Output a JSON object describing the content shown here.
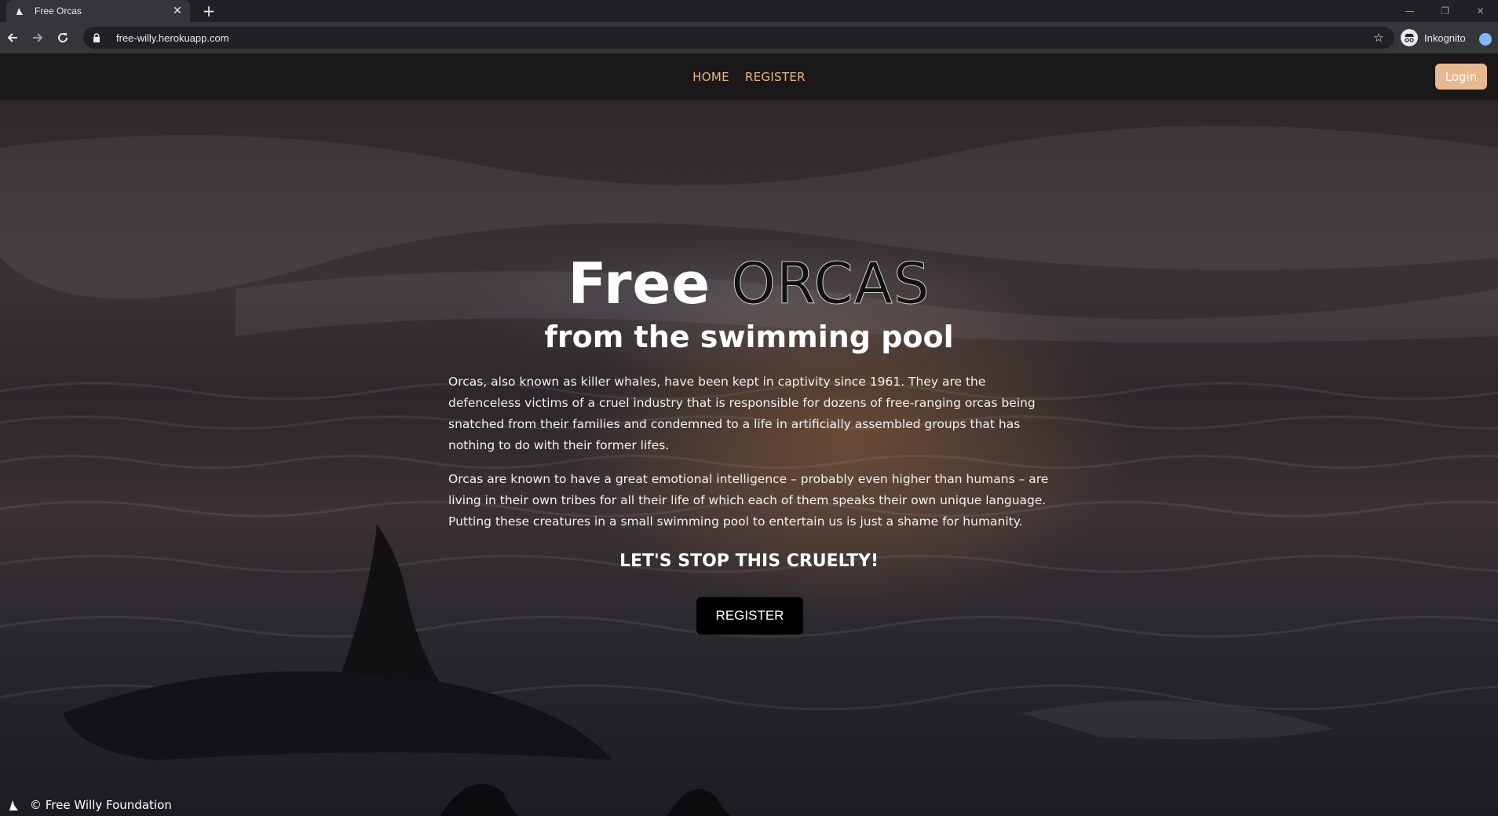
{
  "browser": {
    "tab_title": "Free Orcas",
    "tab_close": "✕",
    "new_tab": "+",
    "url": "free-willy.herokuapp.com",
    "profile_label": "Inkognito",
    "win_minimize": "—",
    "win_restore": "❐",
    "win_close": "✕"
  },
  "nav": {
    "links": [
      "HOME",
      "REGISTER"
    ],
    "login_label": "Login"
  },
  "hero": {
    "title_free": "Free",
    "title_orcas": "ORCAS",
    "subtitle": "from the swimming pool"
  },
  "content": {
    "paragraph1": "Orcas, also known as killer whales, have been kept in captivity since 1961. They are the defenceless victims of a cruel industry that is responsible for dozens of free-ranging orcas being snatched from their families and condemned to a life in artificially assembled groups that has nothing to do with their former lifes.",
    "paragraph2": "Orcas are known to have a great emotional intelligence – probably even higher than humans – are living in their own tribes for all their life of which each of them speaks their own unique language. Putting these creatures in a small swimming pool to entertain us is just a shame for humanity.",
    "call_to_action": "LET'S STOP THIS CRUELTY!",
    "register_button": "REGISTER"
  },
  "footer": {
    "text": "© Free Willy Foundation"
  },
  "colors": {
    "accent": "#e7b582",
    "login_bg": "#e8b98f",
    "browser_dark": "#202124",
    "browser_tab": "#35363a"
  },
  "icons": {
    "favicon": "orca-icon",
    "back": "back-arrow-icon",
    "forward": "forward-arrow-icon",
    "reload": "reload-icon",
    "lock": "lock-icon",
    "star": "star-icon",
    "incognito": "incognito-icon",
    "footer": "orca-icon"
  }
}
